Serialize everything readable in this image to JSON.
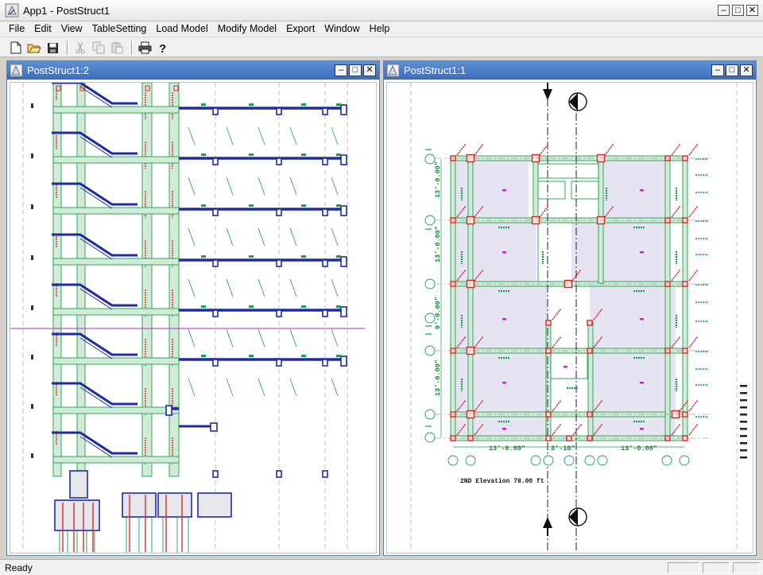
{
  "app": {
    "title": "App1 - PostStruct1"
  },
  "menu": {
    "items": [
      "File",
      "Edit",
      "View",
      "TableSetting",
      "Load Model",
      "Modify Model",
      "Export",
      "Window",
      "Help"
    ]
  },
  "toolbar": {
    "buttons": [
      "new-file-icon",
      "open-folder-icon",
      "save-icon",
      "cut-icon",
      "copy-icon",
      "paste-icon",
      "print-icon",
      "help-icon"
    ]
  },
  "windows": {
    "left": {
      "title": "PostStruct1:2"
    },
    "right": {
      "title": "PostStruct1:1",
      "caption": "2ND Elevation  78.00 ft",
      "dims_left": [
        "13'-0.00\"",
        "13'-0.00\"",
        "9'-0.00\"",
        "13'-0.00\""
      ],
      "dims_bottom": [
        "13'-0.00\"",
        "3'-10\"",
        "13'-0.00\""
      ]
    }
  },
  "status": {
    "text": "Ready"
  },
  "colors": {
    "beam_blue": "#1e2aa8",
    "member_green": "#16a34a",
    "column_red": "#dc2626",
    "slab_fill": "#e6e3f3",
    "member_fill": "#d3ead8",
    "window_title": "#4677c5"
  }
}
